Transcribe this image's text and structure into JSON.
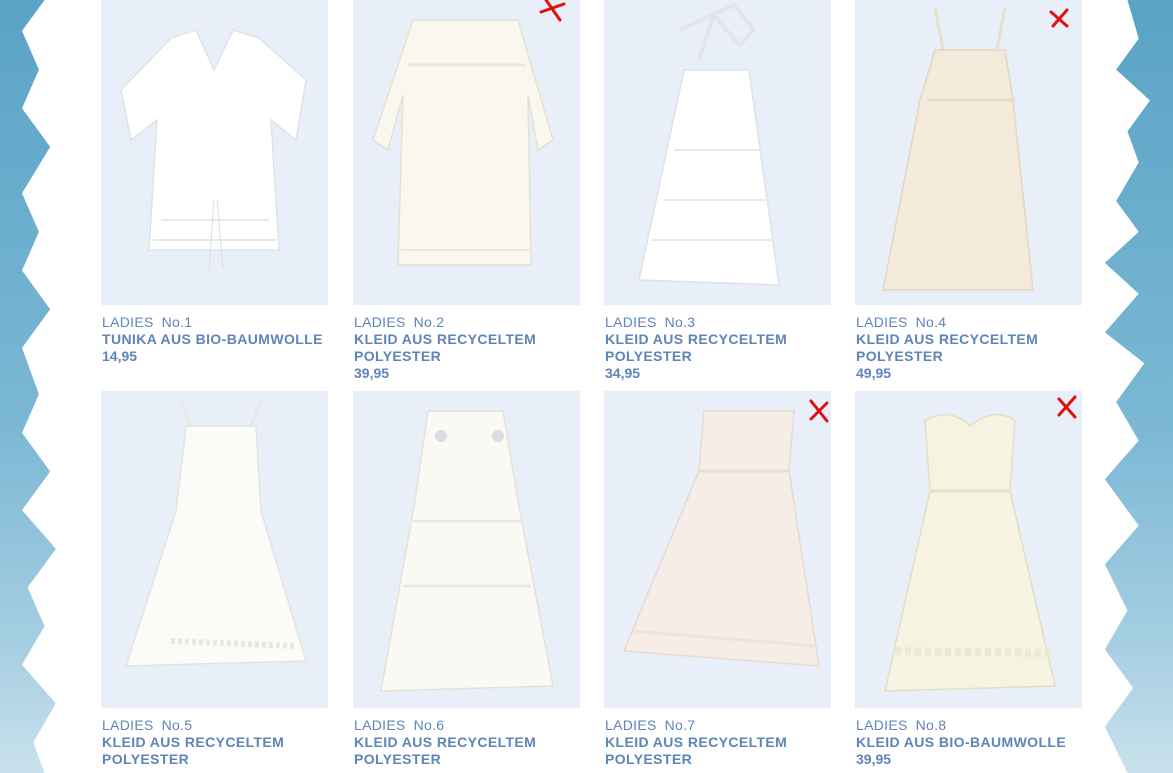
{
  "products": [
    {
      "category": "LADIES",
      "number": "No.1",
      "name": "TUNIKA AUS BIO-BAUMWOLLE",
      "price": "14,95",
      "crossed": false
    },
    {
      "category": "LADIES",
      "number": "No.2",
      "name": "KLEID AUS RECYCELTEM POLYESTER",
      "price": "39,95",
      "crossed": true
    },
    {
      "category": "LADIES",
      "number": "No.3",
      "name": "KLEID AUS RECYCELTEM POLYESTER",
      "price": "34,95",
      "crossed": false
    },
    {
      "category": "LADIES",
      "number": "No.4",
      "name": "KLEID AUS RECYCELTEM POLYESTER",
      "price": "49,95",
      "crossed": true
    },
    {
      "category": "LADIES",
      "number": "No.5",
      "name": "KLEID AUS RECYCELTEM POLYESTER",
      "price": "",
      "crossed": false
    },
    {
      "category": "LADIES",
      "number": "No.6",
      "name": "KLEID AUS RECYCELTEM POLYESTER",
      "price": "",
      "crossed": false
    },
    {
      "category": "LADIES",
      "number": "No.7",
      "name": "KLEID AUS RECYCELTEM POLYESTER",
      "price": "",
      "crossed": true
    },
    {
      "category": "LADIES",
      "number": "No.8",
      "name": "KLEID AUS BIO-BAUMWOLLE",
      "price": "39,95",
      "crossed": true
    }
  ],
  "colors": {
    "text_blue": "#5f84b8",
    "photo_bg": "#e8eff8",
    "mark_red": "#e01010",
    "sky": "#6fb0cf"
  }
}
